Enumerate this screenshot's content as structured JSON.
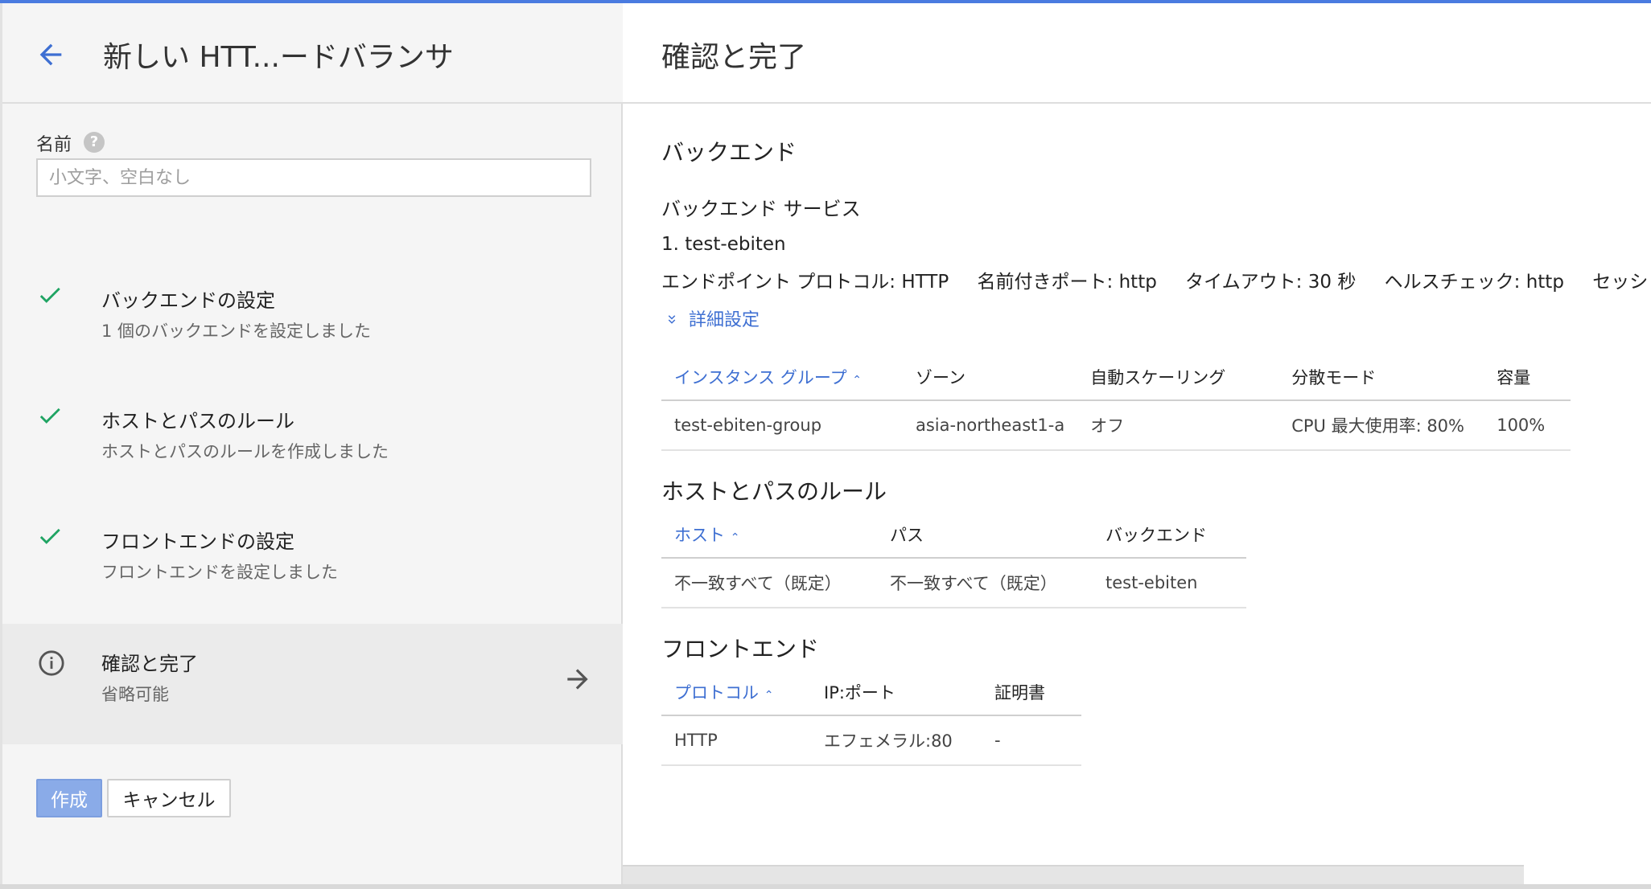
{
  "left": {
    "title": "新しい HTT...ードバランサ",
    "name_label": "名前",
    "name_placeholder": "小文字、空白なし",
    "name_value": "",
    "steps": [
      {
        "title": "バックエンドの設定",
        "subtitle": "1 個のバックエンドを設定しました",
        "status": "check-icon"
      },
      {
        "title": "ホストとパスのルール",
        "subtitle": "ホストとパスのルールを作成しました",
        "status": "check-icon"
      },
      {
        "title": "フロントエンドの設定",
        "subtitle": "フロントエンドを設定しました",
        "status": "check-icon"
      },
      {
        "title": "確認と完了",
        "subtitle": "省略可能",
        "status": "info-icon"
      }
    ],
    "create_label": "作成",
    "cancel_label": "キャンセル"
  },
  "right": {
    "title": "確認と完了",
    "backend": {
      "section_title": "バックエンド",
      "services_title": "バックエンド サービス",
      "service_name": "1. test-ebiten",
      "props": [
        "エンドポイント プロトコル: HTTP",
        "名前付きポート: http",
        "タイムアウト: 30 秒",
        "ヘルスチェック: http",
        "セッション アフ"
      ],
      "detail_link": "詳細設定",
      "table": {
        "headers": [
          "インスタンス グループ",
          "ゾーン",
          "自動スケーリング",
          "分散モード",
          "容量"
        ],
        "rows": [
          [
            "test-ebiten-group",
            "asia-northeast1-a",
            "オフ",
            "CPU 最大使用率: 80%",
            "100%"
          ]
        ]
      }
    },
    "host_path": {
      "section_title": "ホストとパスのルール",
      "table": {
        "headers": [
          "ホスト",
          "パス",
          "バックエンド"
        ],
        "rows": [
          [
            "不一致すべて（既定）",
            "不一致すべて（既定）",
            "test-ebiten"
          ]
        ]
      }
    },
    "frontend": {
      "section_title": "フロントエンド",
      "table": {
        "headers": [
          "プロトコル",
          "IP:ポート",
          "証明書"
        ],
        "rows": [
          [
            "HTTP",
            "エフェメラル:80",
            "-"
          ]
        ]
      }
    }
  },
  "colors": {
    "accent_blue": "#3e6fd2",
    "check_green": "#1fa463",
    "create_button": "#8aabe8",
    "top_bar": "#4a7be0"
  },
  "icons": {
    "back": "arrow-left-icon",
    "help": "help-icon",
    "check": "check-icon",
    "info": "info-icon",
    "next": "arrow-right-icon",
    "sort": "chevron-up-icon",
    "expand": "chevron-down-icon"
  }
}
